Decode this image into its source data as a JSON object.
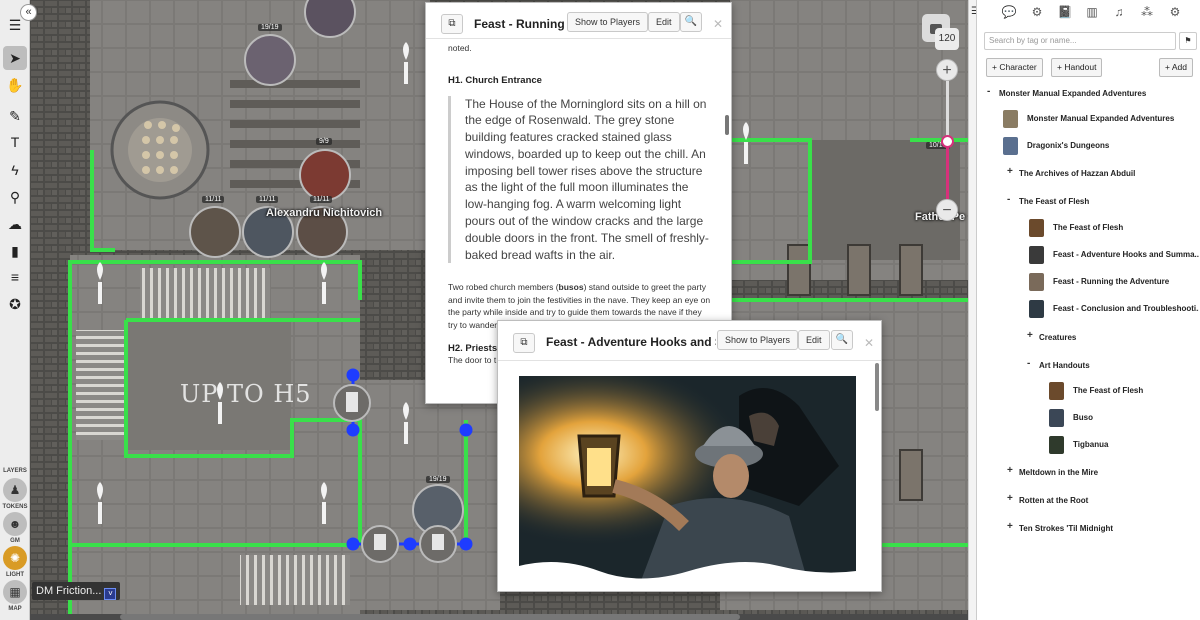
{
  "toolbar": {
    "layers_label": "LAYERS",
    "tokens_label": "TOKENS",
    "gm_label": "GM",
    "light_label": "LIGHT",
    "map_label": "MAP"
  },
  "map": {
    "tokens": [
      {
        "label": "Alexandru Nichitovich"
      },
      {
        "label": "Father Pe"
      }
    ],
    "bars": [
      "19/19",
      "9/9",
      "11/11",
      "11/11",
      "11/11",
      "10/10",
      "19/19"
    ],
    "floor_text": "UP TO H5",
    "player_chip": "DM Friction..."
  },
  "zoom": {
    "value": "120",
    "plus": "+",
    "minus": "−",
    "level": 0.48
  },
  "handout_running": {
    "title": "Feast - Running the Adventure",
    "show_label": "Show to Players",
    "edit_label": "Edit",
    "top_text": "noted.",
    "h1": "H1. Church Entrance",
    "boxed_text": "The House of the Morninglord sits on a hill on the edge of Rosenwald. The grey stone building features cracked stained glass windows, boarded up to keep out the chill. An imposing bell tower rises above the structure as the light of the full moon illuminates the low-hanging fog. A warm welcoming light pours out of the window cracks and the large double doors in the front. The smell of freshly-baked bread wafts in the air.",
    "para_prefix": "Two robed church members (",
    "para_bold": "busos",
    "para_suffix": ") stand outside to greet the party and invite them to join the festivities in the nave. They keep an eye on the party while inside and try to guide them towards the nave if they try to wander around or snoop around.",
    "h2": "H2. Priests'",
    "h2_text": "The door to t"
  },
  "handout_hooks": {
    "title": "Feast - Adventure Hooks and Summary",
    "show_label": "Show to Players",
    "edit_label": "Edit"
  },
  "sidebar": {
    "search_placeholder": "Search by tag or name...",
    "character_btn": "+ Character",
    "handout_btn": "+ Handout",
    "add_btn": "+ Add",
    "items": [
      {
        "label": "Monster Manual Expanded Adventures",
        "pm": "-",
        "level": 0,
        "thumb": ""
      },
      {
        "label": "Monster Manual Expanded Adventures",
        "pm": "",
        "level": 1,
        "thumb": "#8a7c63"
      },
      {
        "label": "Dragonix's Dungeons",
        "pm": "",
        "level": 1,
        "thumb": "#5a6f8f"
      },
      {
        "label": "The Archives of Hazzan Abduil",
        "pm": "+",
        "level": 1,
        "thumb": ""
      },
      {
        "label": "The Feast of Flesh",
        "pm": "-",
        "level": 1,
        "thumb": ""
      },
      {
        "label": "The Feast of Flesh",
        "pm": "",
        "level": 2,
        "thumb": "#6b4a2c"
      },
      {
        "label": "Feast - Adventure Hooks and Summa...",
        "pm": "",
        "level": 2,
        "thumb": "#3a3a3a"
      },
      {
        "label": "Feast - Running the Adventure",
        "pm": "",
        "level": 2,
        "thumb": "#7a6a5a"
      },
      {
        "label": "Feast - Conclusion and Troubleshooti...",
        "pm": "",
        "level": 2,
        "thumb": "#2e3a44"
      },
      {
        "label": "Creatures",
        "pm": "+",
        "level": 2,
        "thumb": ""
      },
      {
        "label": "Art Handouts",
        "pm": "-",
        "level": 2,
        "thumb": ""
      },
      {
        "label": "The Feast of Flesh",
        "pm": "",
        "level": 3,
        "thumb": "#6b4a2c"
      },
      {
        "label": "Buso",
        "pm": "",
        "level": 3,
        "thumb": "#3b4756"
      },
      {
        "label": "Tigbanua",
        "pm": "",
        "level": 3,
        "thumb": "#2f3a2c"
      },
      {
        "label": "Meltdown in the Mire",
        "pm": "+",
        "level": 1,
        "thumb": ""
      },
      {
        "label": "Rotten at the Root",
        "pm": "+",
        "level": 1,
        "thumb": ""
      },
      {
        "label": "Ten Strokes 'Til Midnight",
        "pm": "+",
        "level": 1,
        "thumb": ""
      }
    ]
  },
  "colors": {
    "accent": "#d6317b",
    "gm_layer": "#d99b25",
    "wall": "#39e04a",
    "door": "#1e3cff"
  },
  "icons": [
    "menu-icon",
    "select-icon",
    "pan-icon",
    "draw-icon",
    "text-icon",
    "fx-icon",
    "ruler-icon",
    "weather-icon",
    "card-icon",
    "checklist-icon",
    "settings-icon"
  ]
}
